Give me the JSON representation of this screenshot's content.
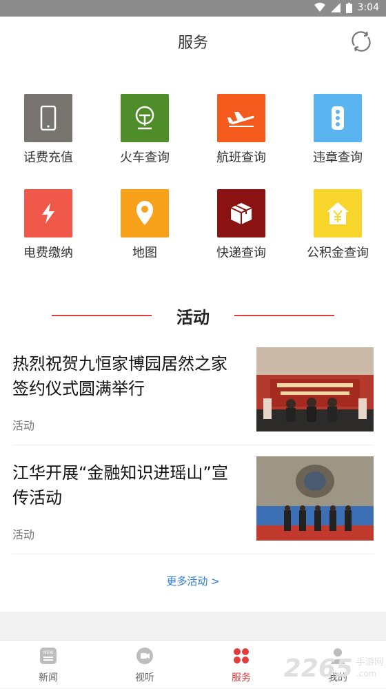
{
  "status_bar": {
    "time": "3:04"
  },
  "header": {
    "title": "服务"
  },
  "services": [
    {
      "label": "话费充值",
      "icon": "phone-icon",
      "color": "#787570"
    },
    {
      "label": "火车查询",
      "icon": "train-icon",
      "color": "#4f8d2a"
    },
    {
      "label": "航班查询",
      "icon": "plane-icon",
      "color": "#f45a1c"
    },
    {
      "label": "违章查询",
      "icon": "traffic-light-icon",
      "color": "#5ab4f0"
    },
    {
      "label": "电费缴纳",
      "icon": "lightning-icon",
      "color": "#f0584a"
    },
    {
      "label": "地图",
      "icon": "map-pin-icon",
      "color": "#f7a21a"
    },
    {
      "label": "快递查询",
      "icon": "package-icon",
      "color": "#8a1213"
    },
    {
      "label": "公积金查询",
      "icon": "house-yuan-icon",
      "color": "#f7d52a"
    }
  ],
  "activity": {
    "section_title": "活动",
    "articles": [
      {
        "headline": "热烈祝贺九恒家博园居然之家签约仪式圆满举行",
        "tag": "活动"
      },
      {
        "headline": "江华开展“金融知识进瑶山”宣传活动",
        "tag": "活动"
      }
    ],
    "more_label": "更多活动 >"
  },
  "tabbar": {
    "tabs": [
      {
        "label": "新闻",
        "icon": "news-icon"
      },
      {
        "label": "视听",
        "icon": "video-icon"
      },
      {
        "label": "服务",
        "icon": "services-icon"
      },
      {
        "label": "我的",
        "icon": "user-icon"
      }
    ],
    "active_color": "#e23b3b"
  },
  "watermark": {
    "number": "2265",
    "text": "手游网",
    "domain": ".com"
  }
}
